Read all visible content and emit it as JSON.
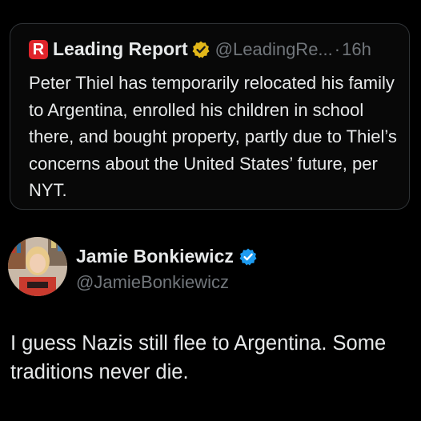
{
  "quoted_post": {
    "brand_letter": "R",
    "author_name": "Leading Report",
    "author_handle": "@LeadingRe...",
    "separator": "·",
    "time": "16h",
    "text": "Peter Thiel has temporarily relocated his family to Argentina, enrolled his children in school there, and bought property, partly due to Thiel’s concerns about the United States’ future, per NYT.",
    "badge": "verified-gold-icon"
  },
  "post": {
    "author_name": "Jamie Bonkiewicz",
    "author_handle": "@JamieBonkiewicz",
    "badge": "verified-blue-icon",
    "text": "I guess Nazis still flee to Argentina. Some traditions never die."
  },
  "colors": {
    "background": "#000000",
    "text": "#e7e9ea",
    "muted": "#71767b",
    "border": "#2f3336",
    "brand_red": "#e0242b",
    "verified_blue": "#1d9bf0",
    "verified_gold": "#e2b719"
  }
}
